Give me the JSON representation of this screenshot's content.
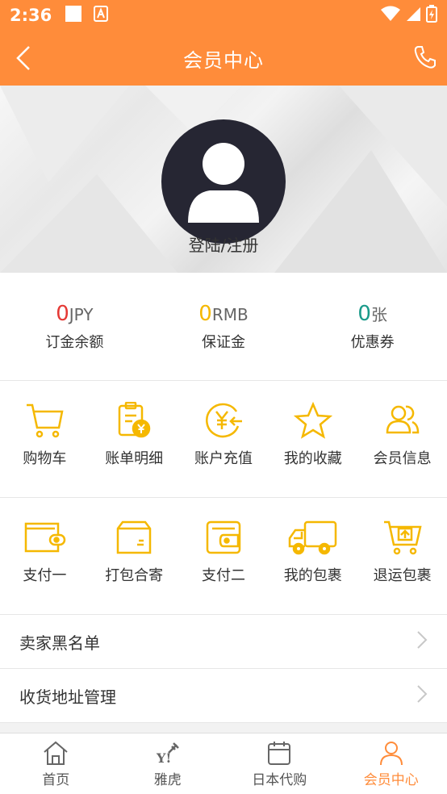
{
  "status_bar": {
    "time": "2:36"
  },
  "nav": {
    "title": "会员中心"
  },
  "profile": {
    "login_label": "登陆/注册"
  },
  "balances": [
    {
      "value": "0",
      "unit": "JPY",
      "label": "订金余额",
      "color": "#e53935"
    },
    {
      "value": "0",
      "unit": "RMB",
      "label": "保证金",
      "color": "#f5b800"
    },
    {
      "value": "0",
      "unit": "张",
      "label": "优惠券",
      "color": "#1a9a8a"
    }
  ],
  "grid1": [
    {
      "label": "购物车",
      "icon": "cart-icon"
    },
    {
      "label": "账单明细",
      "icon": "bill-icon"
    },
    {
      "label": "账户充值",
      "icon": "recharge-icon"
    },
    {
      "label": "我的收藏",
      "icon": "star-icon"
    },
    {
      "label": "会员信息",
      "icon": "members-icon"
    }
  ],
  "grid2": [
    {
      "label": "支付一",
      "icon": "wallet-icon"
    },
    {
      "label": "打包合寄",
      "icon": "box-icon"
    },
    {
      "label": "支付二",
      "icon": "wallet2-icon"
    },
    {
      "label": "我的包裹",
      "icon": "truck-icon"
    },
    {
      "label": "退运包裹",
      "icon": "return-cart-icon"
    }
  ],
  "list": [
    {
      "label": "卖家黑名单"
    },
    {
      "label": "收货地址管理"
    }
  ],
  "tabs": [
    {
      "label": "首页",
      "icon": "home-icon",
      "active": false
    },
    {
      "label": "雅虎",
      "icon": "yahoo-icon",
      "active": false
    },
    {
      "label": "日本代购",
      "icon": "calendar-icon",
      "active": false
    },
    {
      "label": "会员中心",
      "icon": "user-icon",
      "active": true
    }
  ],
  "colors": {
    "primary": "#ff8c3a",
    "accent_icon": "#f5b800",
    "avatar_bg": "#262633"
  }
}
